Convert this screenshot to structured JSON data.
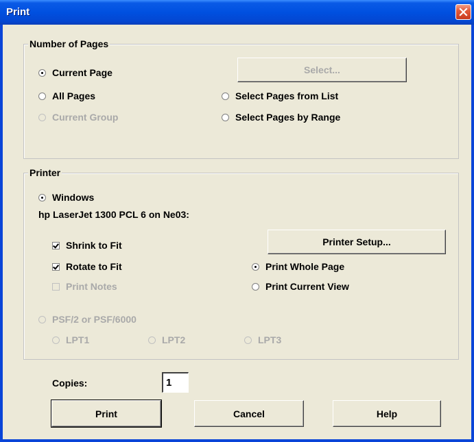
{
  "window": {
    "title": "Print"
  },
  "number_of_pages": {
    "legend": "Number of Pages",
    "current_page": "Current Page",
    "all_pages": "All Pages",
    "current_group": "Current Group",
    "select_button": "Select...",
    "select_from_list": "Select Pages from List",
    "select_by_range": "Select Pages by Range",
    "selected": "Current Page"
  },
  "printer": {
    "legend": "Printer",
    "windows_label": "Windows",
    "printer_name": "hp LaserJet 1300 PCL 6 on Ne03:",
    "shrink_to_fit": "Shrink to Fit",
    "rotate_to_fit": "Rotate to Fit",
    "print_notes": "Print Notes",
    "printer_setup_button": "Printer Setup...",
    "print_whole_page": "Print Whole Page",
    "print_current_view": "Print Current View",
    "psf_label": "PSF/2 or PSF/6000",
    "lpt1": "LPT1",
    "lpt2": "LPT2",
    "lpt3": "LPT3"
  },
  "copies": {
    "label": "Copies:",
    "value": "1"
  },
  "buttons": {
    "print": "Print",
    "cancel": "Cancel",
    "help": "Help"
  },
  "icons": {
    "close": "close-icon"
  },
  "colors": {
    "titlebar": "#0050e0",
    "close": "#e25a3a",
    "face": "#ece9d8"
  }
}
